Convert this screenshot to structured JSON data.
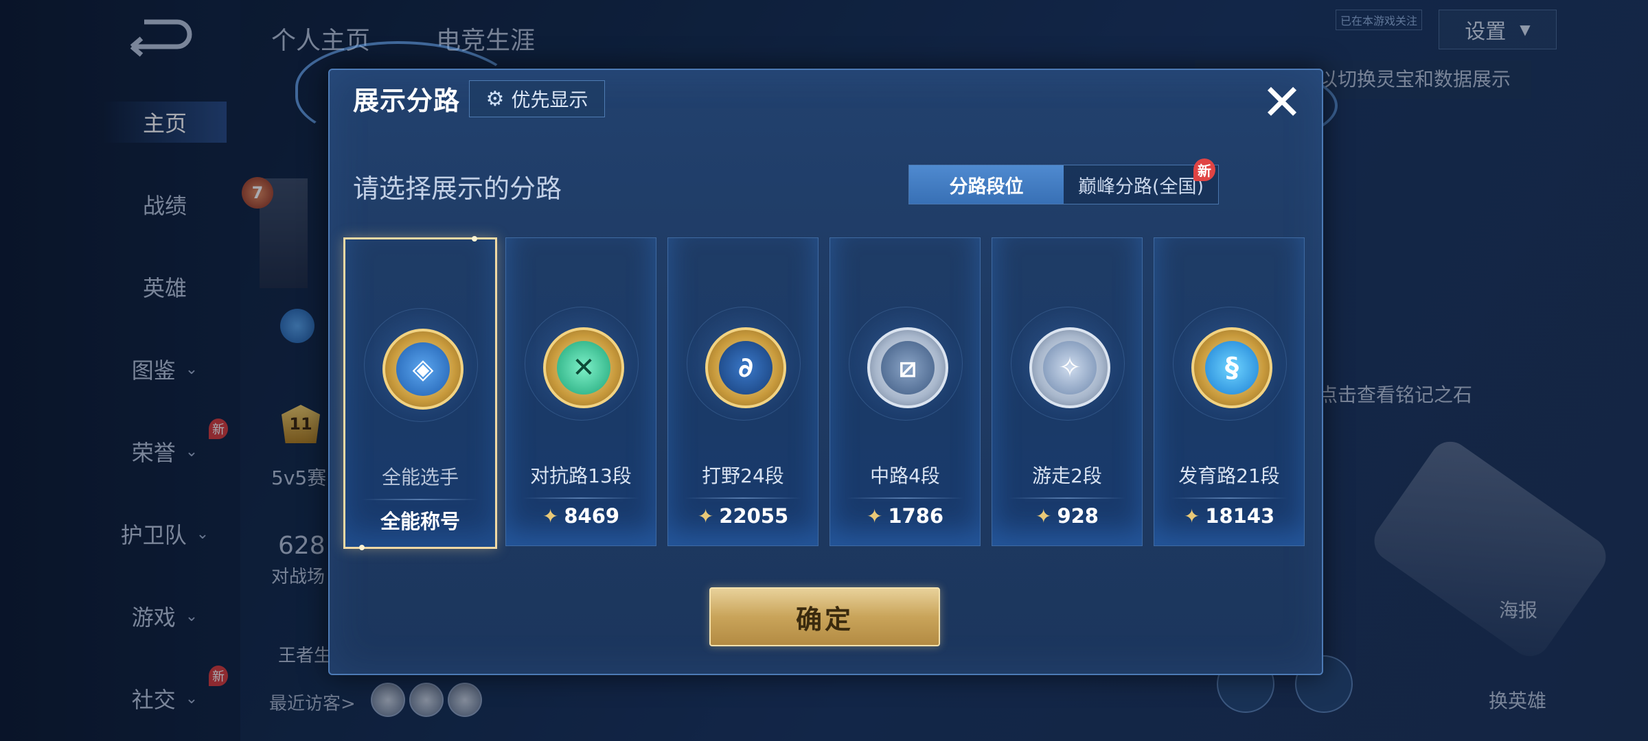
{
  "background": {
    "top_tabs": [
      "个人主页",
      "电竞生涯"
    ],
    "settings_label": "设置",
    "sidebar": {
      "items": [
        {
          "label": "主页",
          "has_chevron": false,
          "is_new": false
        },
        {
          "label": "战绩",
          "has_chevron": false,
          "is_new": false
        },
        {
          "label": "英雄",
          "has_chevron": false,
          "is_new": false
        },
        {
          "label": "图鉴",
          "has_chevron": true,
          "is_new": false
        },
        {
          "label": "荣誉",
          "has_chevron": true,
          "is_new": true
        },
        {
          "label": "护卫队",
          "has_chevron": true,
          "is_new": false
        },
        {
          "label": "游戏",
          "has_chevron": true,
          "is_new": false
        },
        {
          "label": "社交",
          "has_chevron": true,
          "is_new": true
        }
      ],
      "new_label": "新"
    },
    "hint_switch": "以切换灵宝和数据展示",
    "hint_stone": "点击查看铭记之石",
    "recent_visitors": "最近访客>",
    "poster_label": "海报",
    "change_hero_label": "换英雄",
    "profile_level": "7",
    "stat_number": "628",
    "stat_label": "对战场",
    "mode_label": "5v5赛",
    "honor_rank": "11",
    "wangzhe_label": "王者生",
    "tiny_top_label": "已在本游戏关注"
  },
  "modal": {
    "title": "展示分路",
    "priority_label": "优先显示",
    "subtitle": "请选择展示的分路",
    "segment": {
      "options": [
        "分路段位",
        "巅峰分路(全国)"
      ],
      "active_index": 0,
      "new_badge": "新"
    },
    "cards": [
      {
        "label": "全能选手",
        "value": "全能称号",
        "selected": true,
        "show_icon": false,
        "badge": "gold",
        "inner": "in-blue",
        "glyph": "◈"
      },
      {
        "label": "对抗路13段",
        "value": "8469",
        "selected": false,
        "show_icon": true,
        "badge": "gold",
        "inner": "in-green",
        "glyph": "✕"
      },
      {
        "label": "打野24段",
        "value": "22055",
        "selected": false,
        "show_icon": true,
        "badge": "gold",
        "inner": "in-navy",
        "glyph": "∂"
      },
      {
        "label": "中路4段",
        "value": "1786",
        "selected": false,
        "show_icon": true,
        "badge": "silver",
        "inner": "in-steel",
        "glyph": "⧄"
      },
      {
        "label": "游走2段",
        "value": "928",
        "selected": false,
        "show_icon": true,
        "badge": "silver",
        "inner": "in-pale",
        "glyph": "✧"
      },
      {
        "label": "发育路21段",
        "value": "18143",
        "selected": false,
        "show_icon": true,
        "badge": "gold",
        "inner": "in-cyan",
        "glyph": "§"
      }
    ],
    "confirm_label": "确定",
    "close_symbol": "✕"
  }
}
